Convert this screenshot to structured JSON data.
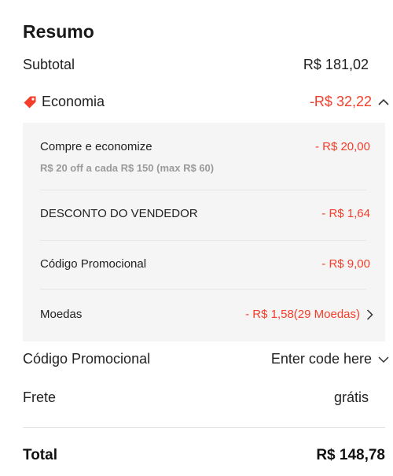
{
  "summary": {
    "title": "Resumo",
    "subtotal": {
      "label": "Subtotal",
      "value": "R$ 181,02"
    },
    "savings": {
      "label": "Economia",
      "value": "-R$ 32,22",
      "icon": "tag-icon",
      "toggle_icon": "chevron-up-icon"
    },
    "savings_details": [
      {
        "label": "Compre e economize",
        "sub": "R$ 20 off a cada R$ 150 (max R$ 60)",
        "value": "- R$ 20,00"
      },
      {
        "label": "DESCONTO DO VENDEDOR",
        "value": "- R$ 1,64"
      },
      {
        "label": "Código Promocional",
        "value": "- R$ 9,00"
      },
      {
        "label": "Moedas",
        "value": "- R$ 1,58(29 Moedas)",
        "icon": "chevron-right-icon"
      }
    ],
    "promo_code": {
      "label": "Código Promocional",
      "placeholder": "Enter code here",
      "icon": "chevron-down-icon"
    },
    "shipping": {
      "label": "Frete",
      "value": "grátis"
    },
    "total": {
      "label": "Total",
      "value": "R$ 148,78"
    }
  },
  "colors": {
    "accent_red": "#f23e2a",
    "panel_bg": "#f5f5f5"
  }
}
